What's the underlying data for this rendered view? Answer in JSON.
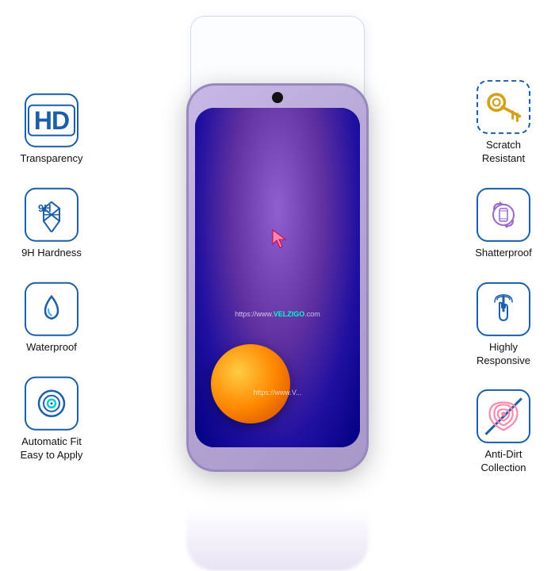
{
  "features": {
    "left": [
      {
        "id": "hd-transparency",
        "icon": "hd",
        "label": "Transparency"
      },
      {
        "id": "9h-hardness",
        "icon": "9h-diamond",
        "label": "9H Hardness"
      },
      {
        "id": "waterproof",
        "icon": "droplet",
        "label": "Waterproof"
      },
      {
        "id": "auto-fit",
        "icon": "circle-target",
        "label": "Automatic Fit\nEasy to Apply"
      }
    ],
    "right": [
      {
        "id": "scratch-resistant",
        "icon": "key",
        "label": "Scratch\nResistant"
      },
      {
        "id": "shatterproof",
        "icon": "rotate",
        "label": "Shatterproof"
      },
      {
        "id": "highly-responsive",
        "icon": "touch",
        "label": "Highly\nResponsive"
      },
      {
        "id": "anti-dirt",
        "icon": "fingerprint",
        "label": "Anti-Dirt\nCollection"
      }
    ]
  },
  "phone": {
    "watermark": "https://www.VELZIGO.com",
    "watermark2": "https://www.V..."
  },
  "brand": "VELZIGO"
}
